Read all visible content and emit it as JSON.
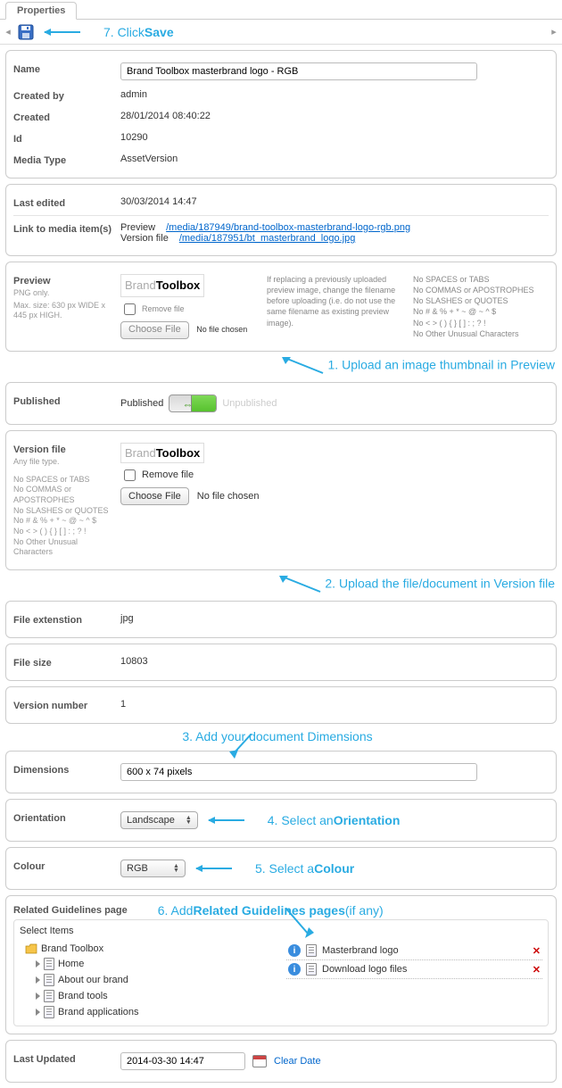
{
  "tab": "Properties",
  "annotations": {
    "a1_pre": "1. Upload an image thumbnail in ",
    "a1_bold": "Preview",
    "a2_pre": "2. Upload the file/document in ",
    "a2_bold": "Version file",
    "a3_pre": "3. Add your document ",
    "a3_bold": "Dimensions",
    "a4_pre": "4. Select an ",
    "a4_bold": "Orientation",
    "a5_pre": "5. Select a ",
    "a5_bold": "Colour",
    "a6_pre": "6. Add ",
    "a6_bold": "Related Guidelines pages",
    "a6_post": " (if any)",
    "a7_pre": "7. Click ",
    "a7_bold": "Save"
  },
  "basic": {
    "name_label": "Name",
    "name_value": "Brand Toolbox masterbrand logo - RGB",
    "createdby_label": "Created by",
    "createdby_value": "admin",
    "created_label": "Created",
    "created_value": "28/01/2014 08:40:22",
    "id_label": "Id",
    "id_value": "10290",
    "mediatype_label": "Media Type",
    "mediatype_value": "AssetVersion"
  },
  "links": {
    "lastedited_label": "Last edited",
    "lastedited_value": "30/03/2014 14:47",
    "linkto_label": "Link to media item(s)",
    "preview_label": "Preview",
    "preview_url": "/media/187949/brand-toolbox-masterbrand-logo-rgb.png",
    "versionfile_label": "Version file",
    "versionfile_url": "/media/187951/bt_masterbrand_logo.jpg"
  },
  "preview": {
    "label": "Preview",
    "sub1": "PNG only.",
    "sub2": "Max. size: 630 px WIDE x 445 px HIGH.",
    "remove_label": "Remove file",
    "choose_label": "Choose File",
    "no_file": "No file chosen",
    "note_col2": "If replacing a previously uploaded preview image, change the filename before uploading (i.e. do not use the same filename as existing preview image).",
    "note_col3_1": "No SPACES or TABS",
    "note_col3_2": "No COMMAS or APOSTROPHES",
    "note_col3_3": "No SLASHES or QUOTES",
    "note_col3_4": "No # & % + * ~ @ ~ ^ $",
    "note_col3_5": "No < > ( ) { } [ ] : ; ? !",
    "note_col3_6": "No Other Unusual Characters"
  },
  "published": {
    "label": "Published",
    "on": "Published",
    "off": "Unpublished"
  },
  "versionfile": {
    "label": "Version file",
    "sub1": "Any file type.",
    "remove_label": "Remove file",
    "choose_label": "Choose File",
    "no_file": "No file chosen",
    "note1": "No SPACES or TABS",
    "note2": "No COMMAS or APOSTROPHES",
    "note3": "No SLASHES or QUOTES",
    "note4": "No # & % + * ~ @ ~ ^ $",
    "note5": "No < > ( ) { } [ ] : ; ? !",
    "note6": "No Other Unusual Characters"
  },
  "fileext": {
    "label": "File extenstion",
    "value": "jpg"
  },
  "filesize": {
    "label": "File size",
    "value": "10803"
  },
  "versionnum": {
    "label": "Version number",
    "value": "1"
  },
  "dimensions": {
    "label": "Dimensions",
    "value": "600 x 74 pixels"
  },
  "orientation": {
    "label": "Orientation",
    "value": "Landscape"
  },
  "colour": {
    "label": "Colour",
    "value": "RGB"
  },
  "related": {
    "label": "Related Guidelines page",
    "select_items": "Select Items",
    "root": "Brand Toolbox",
    "children": [
      "Home",
      "About our brand",
      "Brand tools",
      "Brand applications"
    ],
    "selected": [
      "Masterbrand logo",
      "Download logo files"
    ]
  },
  "lastupdated": {
    "label": "Last Updated",
    "value": "2014-03-30 14:47",
    "clear": "Clear Date"
  },
  "brand": {
    "p1": "Brand",
    "p2": "Toolbox"
  }
}
